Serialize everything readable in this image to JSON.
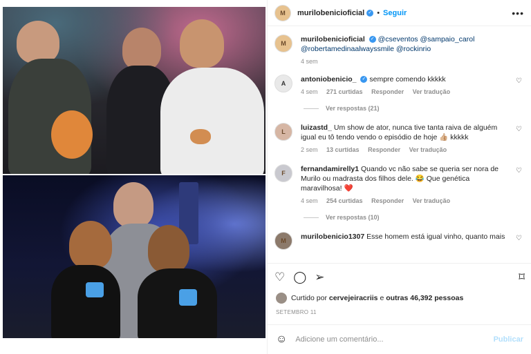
{
  "post": {
    "author": "murilobenicioficial",
    "follow_label": "Seguir",
    "more_icon": "more-options-icon"
  },
  "caption": {
    "username": "murilobenicioficial",
    "mentions": "@cseventos @sampaio_carol @robertamedinaalwayssmile @rockinrio",
    "time": "4 sem"
  },
  "comments": [
    {
      "username": "antoniobenicio_",
      "verified": true,
      "text": "sempre comendo kkkkk",
      "time": "4 sem",
      "likes": "271 curtidas",
      "reply": "Responder",
      "translate": "Ver tradução",
      "view_replies": "Ver respostas (21)"
    },
    {
      "username": "luizastd_",
      "verified": false,
      "text": "Um show de ator, nunca tive tanta raiva de alguém igual eu tô tendo vendo o episódio de hoje 👍🏼 kkkkk",
      "time": "2 sem",
      "likes": "13 curtidas",
      "reply": "Responder",
      "translate": "Ver tradução"
    },
    {
      "username": "fernandamirelly1",
      "verified": false,
      "text": "Quando vc não sabe se queria ser nora de Murilo ou madrasta dos filhos dele. 😂 Que genética maravilhosa! ❤️",
      "time": "4 sem",
      "likes": "254 curtidas",
      "reply": "Responder",
      "translate": "Ver tradução",
      "view_replies": "Ver respostas (10)"
    },
    {
      "username": "murilobenicio1307",
      "verified": false,
      "text": "Esse homem está igual vinho, quanto mais"
    }
  ],
  "liked_by": {
    "prefix": "Curtido por",
    "user": "cervejeiracriis",
    "conj": "e",
    "others": "outras 46,392 pessoas"
  },
  "date": "SETEMBRO 11",
  "add_comment": {
    "placeholder": "Adicione um comentário...",
    "publish_label": "Publicar"
  },
  "colors": {
    "link": "#0095f6",
    "verified": "#3897f0",
    "meta": "#8e8e8e",
    "heart_red": "#ed4956"
  }
}
